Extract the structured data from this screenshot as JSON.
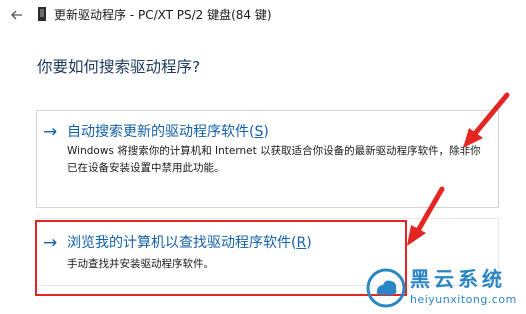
{
  "window": {
    "title": "更新驱动程序 - PC/XT PS/2 键盘(84 键)",
    "back_icon": "back-arrow-icon",
    "device_icon": "device-icon"
  },
  "main": {
    "heading": "你要如何搜索驱动程序?",
    "options": [
      {
        "arrow": "→",
        "title_text": "自动搜索更新的驱动程序软件(",
        "title_key": "S",
        "title_end": ")",
        "description": "Windows 将搜索你的计算机和 Internet 以获取适合你设备的最新驱动程序软件，除非你已在设备安装设置中禁用此功能。"
      },
      {
        "arrow": "→",
        "title_text": "浏览我的计算机以查找驱动程序软件(",
        "title_key": "R",
        "title_end": ")",
        "description": "手动查找并安装驱动程序软件。"
      }
    ]
  },
  "annotations": {
    "highlight_color": "#e52521"
  },
  "watermark": {
    "name": "黑云系统",
    "url": "heiyunxitong.com",
    "color": "#2b86c5"
  }
}
